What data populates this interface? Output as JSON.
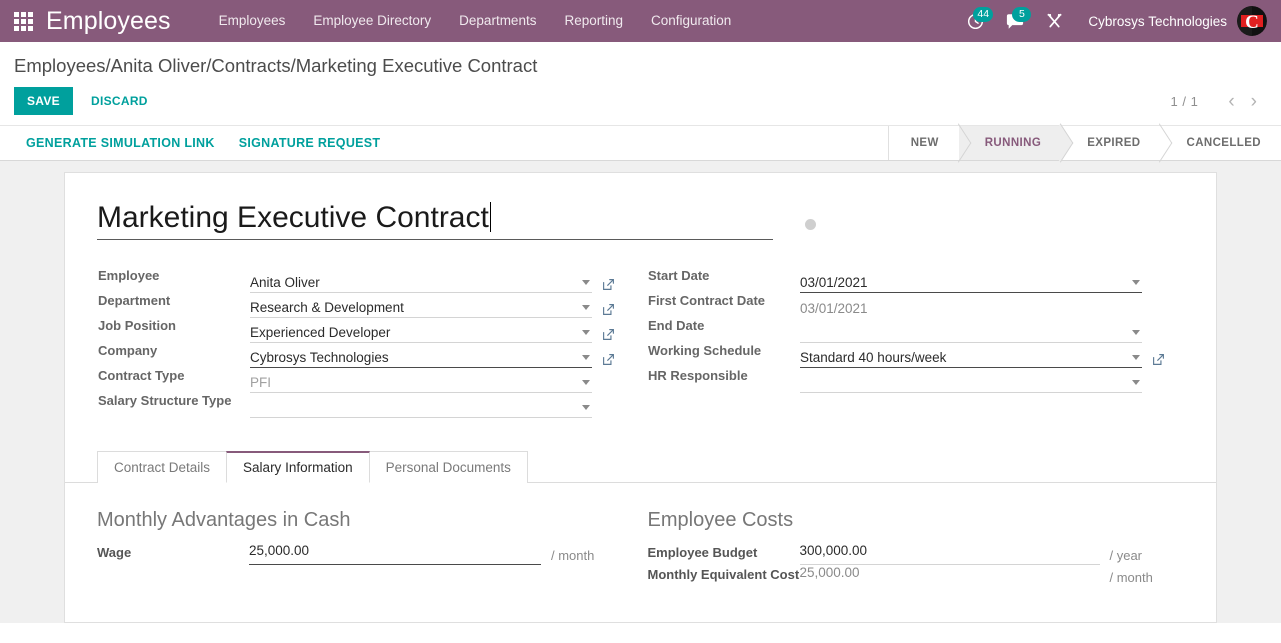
{
  "navbar": {
    "apps_icon": "apps-grid-icon",
    "brand": "Employees",
    "menu": [
      {
        "label": "Employees"
      },
      {
        "label": "Employee Directory"
      },
      {
        "label": "Departments"
      },
      {
        "label": "Reporting"
      },
      {
        "label": "Configuration"
      }
    ],
    "activity_icon": "clock-icon",
    "activity_count": "44",
    "messages_icon": "chat-bubble-icon",
    "messages_count": "5",
    "debug_icon": "wrench-tools-icon",
    "user_name": "Cybrosys Technologies",
    "avatar_icon": "user-avatar",
    "bg_color": "#875A7B",
    "badge_color": "#00A09D"
  },
  "breadcrumb": {
    "items": [
      {
        "label": "Employees",
        "link": true
      },
      {
        "label": "Anita Oliver",
        "link": true
      },
      {
        "label": "Contracts",
        "link": true
      },
      {
        "label": "Marketing Executive Contract",
        "link": false
      }
    ],
    "separator": "/"
  },
  "actions": {
    "save_label": "SAVE",
    "discard_label": "DISCARD",
    "accent_color": "#00A09D"
  },
  "pager": {
    "counter": "1 / 1",
    "prev_icon": "chevron-left-icon",
    "next_icon": "chevron-right-icon"
  },
  "statusbar_buttons": [
    {
      "label": "GENERATE SIMULATION LINK"
    },
    {
      "label": "SIGNATURE REQUEST"
    }
  ],
  "statusbar": {
    "states": [
      {
        "label": "NEW",
        "active": false
      },
      {
        "label": "RUNNING",
        "active": true
      },
      {
        "label": "EXPIRED",
        "active": false
      },
      {
        "label": "CANCELLED",
        "active": false
      }
    ],
    "active_color": "#875A7B"
  },
  "form": {
    "title": "Marketing Executive Contract",
    "kanban_state": "gray-dot",
    "left_fields": [
      {
        "label": "Employee",
        "value": "Anita Oliver",
        "placeholder": "",
        "state": "value",
        "dropdown": true,
        "external": true
      },
      {
        "label": "Department",
        "value": "Research & Development",
        "placeholder": "",
        "state": "value",
        "dropdown": true,
        "external": true
      },
      {
        "label": "Job Position",
        "value": "Experienced Developer",
        "placeholder": "",
        "state": "value",
        "dropdown": true,
        "external": true
      },
      {
        "label": "Company",
        "value": "Cybrosys Technologies",
        "placeholder": "",
        "state": "focused",
        "dropdown": true,
        "external": true
      },
      {
        "label": "Contract Type",
        "value": "",
        "placeholder": "PFI",
        "state": "placeholder",
        "dropdown": true,
        "external": false
      },
      {
        "label": "Salary Structure Type",
        "value": "",
        "placeholder": "",
        "state": "empty",
        "dropdown": true,
        "external": false
      }
    ],
    "right_fields": [
      {
        "label": "Start Date",
        "value": "03/01/2021",
        "placeholder": "",
        "state": "focused",
        "dropdown": true,
        "external": false
      },
      {
        "label": "First Contract Date",
        "value": "03/01/2021",
        "placeholder": "",
        "state": "readonly",
        "dropdown": false,
        "external": false
      },
      {
        "label": "End Date",
        "value": "",
        "placeholder": "",
        "state": "empty",
        "dropdown": true,
        "external": false
      },
      {
        "label": "Working Schedule",
        "value": "Standard 40 hours/week",
        "placeholder": "",
        "state": "focused",
        "dropdown": true,
        "external": true
      },
      {
        "label": "HR Responsible",
        "value": "",
        "placeholder": "",
        "state": "empty",
        "dropdown": true,
        "external": false
      }
    ]
  },
  "notebook": {
    "tabs": [
      {
        "label": "Contract Details",
        "active": false
      },
      {
        "label": "Salary Information",
        "active": true
      },
      {
        "label": "Personal Documents",
        "active": false
      }
    ]
  },
  "salary_page": {
    "left": {
      "section_title": "Monthly Advantages in Cash",
      "fields": [
        {
          "label": "Wage",
          "value": "25,000.00",
          "unit": "/ month",
          "state": "editable"
        }
      ]
    },
    "right": {
      "section_title": "Employee Costs",
      "fields": [
        {
          "label": "Employee Budget",
          "value": "300,000.00",
          "unit": "/ year",
          "state": "editable-light"
        },
        {
          "label": "Monthly Equivalent Cost",
          "value": "25,000.00",
          "unit": "/ month",
          "state": "readonly"
        }
      ]
    }
  }
}
